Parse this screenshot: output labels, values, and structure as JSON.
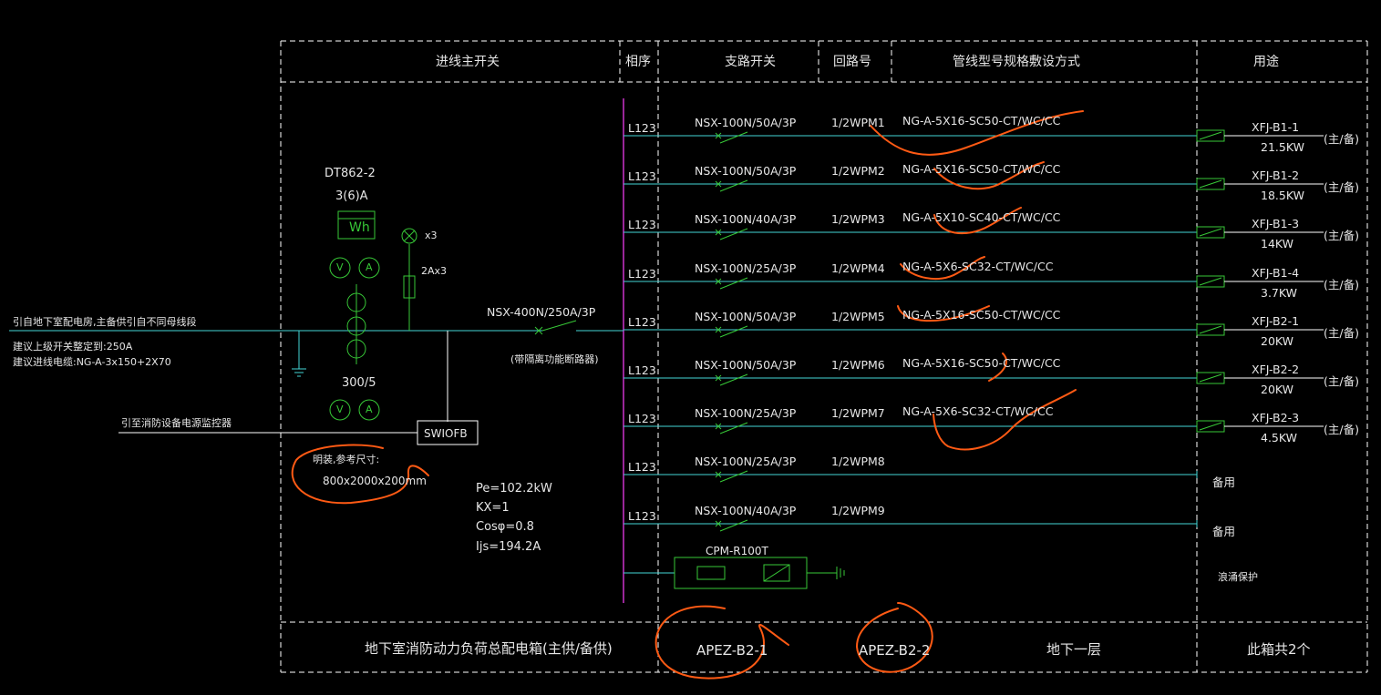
{
  "header": {
    "incoming_switch": "进线主开关",
    "phase": "相序",
    "branch_switch": "支路开关",
    "circuit_no": "回路号",
    "cable_spec": "管线型号规格敷设方式",
    "usage": "用途"
  },
  "incoming": {
    "source_note": "引自地下室配电房,主备供引自不同母线段",
    "upper_switch_note": "建议上级开关整定到:250A",
    "cable_note": "建议进线电缆:NG-A-3x150+2X70",
    "fire_monitor_note": "引至消防设备电源监控器",
    "meter_model": "DT862-2",
    "meter_rating": "3(6)A",
    "meter_label": "Wh",
    "lamp_label": "x3",
    "fuse_label": "2Ax3",
    "ct_ratio": "300/5",
    "volt_label": "V",
    "amp_label": "A",
    "monitor_box": "SWIOFB",
    "main_breaker": "NSX-400N/250A/3P",
    "main_breaker_note": "(带隔离功能断路器)",
    "box_size_title": "明装,参考尺寸:",
    "box_size": "800x2000x200mm"
  },
  "calc": {
    "pe": "Pe=102.2kW",
    "kx": "KX=1",
    "cos": "Cosφ=0.8",
    "ijs": "Ijs=194.2A"
  },
  "circuits": [
    {
      "phase": "L123",
      "breaker": "NSX-100N/50A/3P",
      "circuit": "1/2WPM1",
      "cable": "NG-A-5X16-SC50-CT/WC/CC",
      "load": "XFJ-B1-1",
      "power": "21.5KW",
      "role": "(主/备)"
    },
    {
      "phase": "L123",
      "breaker": "NSX-100N/50A/3P",
      "circuit": "1/2WPM2",
      "cable": "NG-A-5X16-SC50-CT/WC/CC",
      "load": "XFJ-B1-2",
      "power": "18.5KW",
      "role": "(主/备)"
    },
    {
      "phase": "L123",
      "breaker": "NSX-100N/40A/3P",
      "circuit": "1/2WPM3",
      "cable": "NG-A-5X10-SC40-CT/WC/CC",
      "load": "XFJ-B1-3",
      "power": "14KW",
      "role": "(主/备)"
    },
    {
      "phase": "L123",
      "breaker": "NSX-100N/25A/3P",
      "circuit": "1/2WPM4",
      "cable": "NG-A-5X6-SC32-CT/WC/CC",
      "load": "XFJ-B1-4",
      "power": "3.7KW",
      "role": "(主/备)"
    },
    {
      "phase": "L123",
      "breaker": "NSX-100N/50A/3P",
      "circuit": "1/2WPM5",
      "cable": "NG-A-5X16-SC50-CT/WC/CC",
      "load": "XFJ-B2-1",
      "power": "20KW",
      "role": "(主/备)"
    },
    {
      "phase": "L123",
      "breaker": "NSX-100N/50A/3P",
      "circuit": "1/2WPM6",
      "cable": "NG-A-5X16-SC50-CT/WC/CC",
      "load": "XFJ-B2-2",
      "power": "20KW",
      "role": "(主/备)"
    },
    {
      "phase": "L123",
      "breaker": "NSX-100N/25A/3P",
      "circuit": "1/2WPM7",
      "cable": "NG-A-5X6-SC32-CT/WC/CC",
      "load": "XFJ-B2-3",
      "power": "4.5KW",
      "role": "(主/备)"
    },
    {
      "phase": "L123",
      "breaker": "NSX-100N/25A/3P",
      "circuit": "1/2WPM8",
      "cable": "",
      "load": "",
      "power": "",
      "role": "",
      "spare": "备用"
    },
    {
      "phase": "L123",
      "breaker": "NSX-100N/40A/3P",
      "circuit": "1/2WPM9",
      "cable": "",
      "load": "",
      "power": "",
      "role": "",
      "spare": "备用"
    }
  ],
  "spd": {
    "model": "CPM-R100T",
    "usage": "浪涌保护"
  },
  "footer": {
    "title": "地下室消防动力负荷总配电箱(主供/备供)",
    "box1": "APEZ-B2-1",
    "box2": "APEZ-B2-2",
    "floor": "地下一层",
    "count": "此箱共2个"
  },
  "colors": {
    "background": "#000000",
    "frame": "#ffffff",
    "bus": "#cc33cc",
    "feeder": "#44d6d6",
    "device": "#37c837",
    "markup": "#ff5a14",
    "text": "#e6e6e6"
  }
}
